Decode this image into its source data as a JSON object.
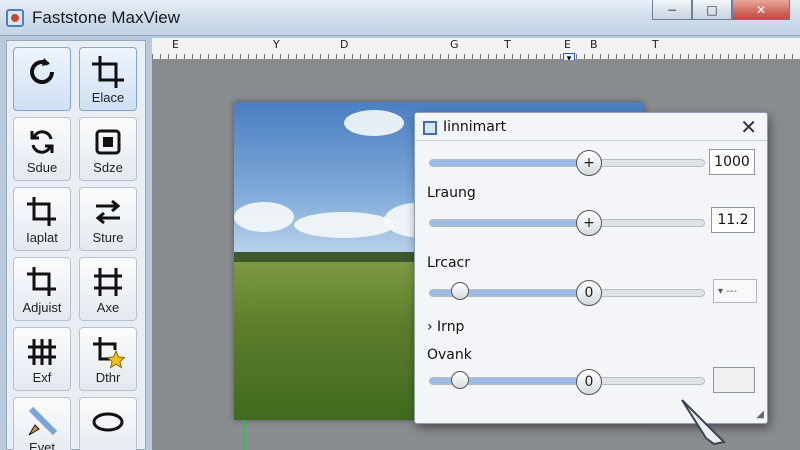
{
  "window": {
    "title": "Faststone MaxView",
    "buttons": [
      "−",
      "□",
      "✕"
    ]
  },
  "tools": [
    {
      "label": "",
      "icon": "rotate-icon"
    },
    {
      "label": "Elace",
      "icon": "crop-icon"
    },
    {
      "label": "Sdue",
      "icon": "refresh-icon"
    },
    {
      "label": "Sdze",
      "icon": "stop-square-icon"
    },
    {
      "label": "Iaplat",
      "icon": "crop-icon"
    },
    {
      "label": "Sture",
      "icon": "arrows-icon"
    },
    {
      "label": "Adjuist",
      "icon": "crop-icon"
    },
    {
      "label": "Axe",
      "icon": "adjust-grid-icon"
    },
    {
      "label": "Exf",
      "icon": "levels-icon"
    },
    {
      "label": "Dthr",
      "icon": "star-crop-icon"
    },
    {
      "label": "Eyet",
      "icon": "brush-icon"
    },
    {
      "label": "",
      "icon": "ellipse-icon"
    }
  ],
  "ruler": {
    "letters": [
      "E",
      "Y",
      "D",
      "G",
      "T",
      "E",
      "B",
      "T"
    ]
  },
  "dialog": {
    "title": "Iinnimart",
    "close": "✕",
    "slider1": {
      "value": "1000",
      "level": 0.58
    },
    "slider2": {
      "label": "Lraung",
      "value": "11.2",
      "level": 0.58
    },
    "slider3": {
      "label": "Lrcacr",
      "value": "0",
      "level": 0.58,
      "dropdown": "▾ ---"
    },
    "expander": "› Irnp",
    "slider4": {
      "label": "Ovank",
      "value": "0",
      "level": 0.58
    }
  },
  "colors": {
    "accent": "#9dbce4",
    "titlebar": "#cddbe9",
    "canvas": "#8a8d90"
  }
}
